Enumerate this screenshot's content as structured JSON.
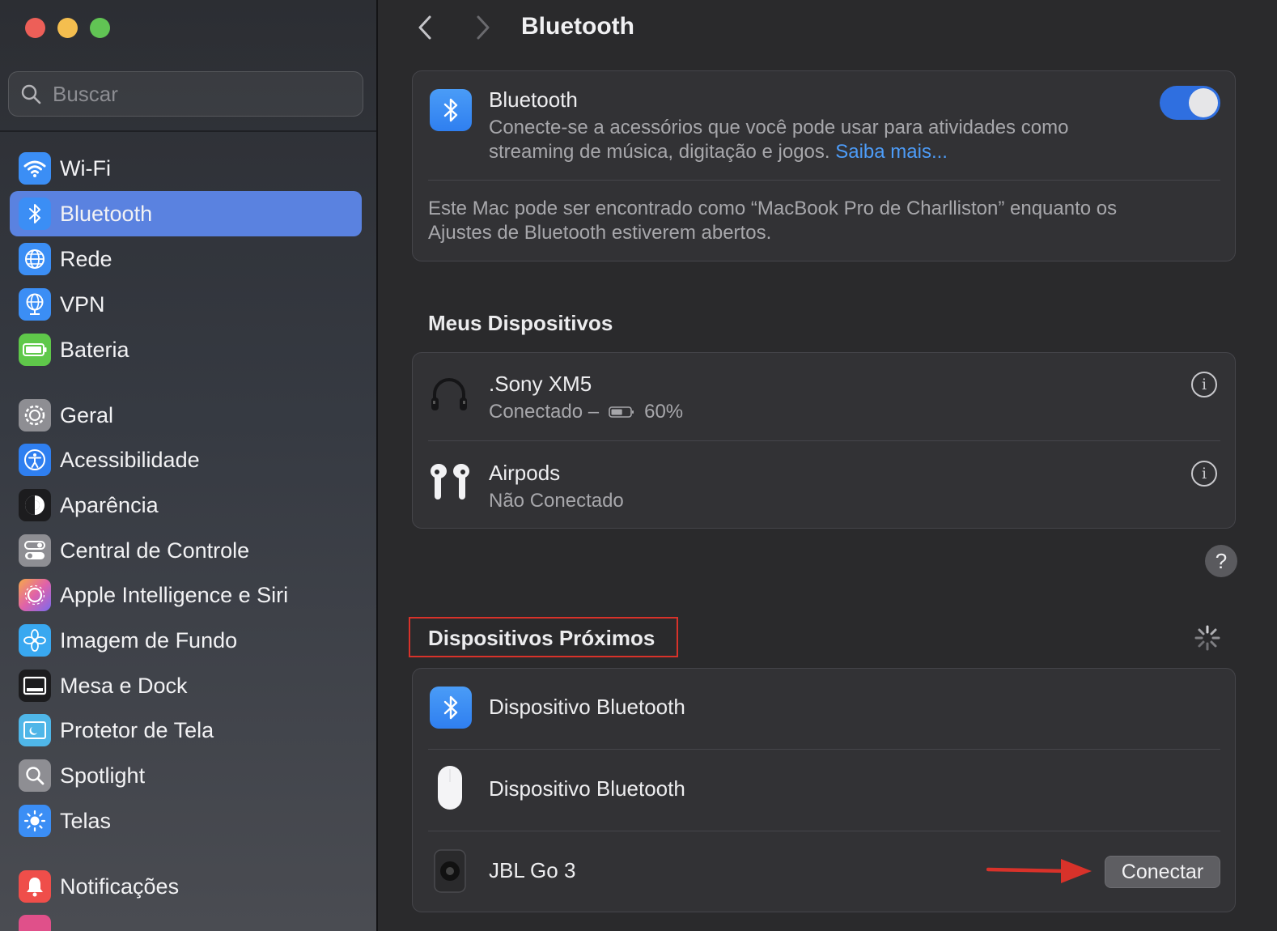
{
  "window": {
    "title": "Bluetooth"
  },
  "search": {
    "placeholder": "Buscar"
  },
  "sidebar": {
    "items": [
      {
        "label": "Wi-Fi",
        "icon": "wifi-icon",
        "color": "#3b8ef5",
        "active": false
      },
      {
        "label": "Bluetooth",
        "icon": "bluetooth-icon",
        "color": "#3b8ef5",
        "active": true
      },
      {
        "label": "Rede",
        "icon": "globe-icon",
        "color": "#3b8ef5",
        "active": false
      },
      {
        "label": "VPN",
        "icon": "vpn-globe-icon",
        "color": "#3b8ef5",
        "active": false
      },
      {
        "label": "Bateria",
        "icon": "battery-icon",
        "color": "#5fc84a",
        "active": false
      },
      {
        "label": "Geral",
        "icon": "gear-icon",
        "color": "#8e8e93",
        "active": false
      },
      {
        "label": "Acessibilidade",
        "icon": "accessibility-icon",
        "color": "#2f7ff0",
        "active": false
      },
      {
        "label": "Aparência",
        "icon": "appearance-icon",
        "color": "#1c1c1e",
        "active": false
      },
      {
        "label": "Central de Controle",
        "icon": "control-center-icon",
        "color": "#8e8e93",
        "active": false
      },
      {
        "label": "Apple Intelligence e Siri",
        "icon": "siri-icon",
        "color": "#e062a8",
        "active": false
      },
      {
        "label": "Imagem de Fundo",
        "icon": "wallpaper-icon",
        "color": "#39a8f0",
        "active": false
      },
      {
        "label": "Mesa e Dock",
        "icon": "dock-icon",
        "color": "#1c1c1e",
        "active": false
      },
      {
        "label": "Protetor de Tela",
        "icon": "screensaver-icon",
        "color": "#4fb6e8",
        "active": false
      },
      {
        "label": "Spotlight",
        "icon": "spotlight-icon",
        "color": "#8e8e93",
        "active": false
      },
      {
        "label": "Telas",
        "icon": "displays-icon",
        "color": "#3b8ef5",
        "active": false
      },
      {
        "label": "Notificações",
        "icon": "notifications-icon",
        "color": "#ef4e4a",
        "active": false
      }
    ]
  },
  "bluetooth_card": {
    "title": "Bluetooth",
    "description": "Conecte-se a acessórios que você pode usar para atividades como",
    "description2": "streaming de música, digitação e jogos.",
    "link": "Saiba mais...",
    "toggle_on": true,
    "discoverable_line1": "Este Mac pode ser encontrado como “MacBook Pro de Charlliston” enquanto os",
    "discoverable_line2": "Ajustes de Bluetooth estiverem abertos."
  },
  "my_devices": {
    "title": "Meus Dispositivos",
    "items": [
      {
        "name": ".Sony XM5",
        "status": "Conectado –",
        "battery": "60%",
        "battery_level": 0.6,
        "icon": "headphones-icon"
      },
      {
        "name": "Airpods",
        "status": "Não Conectado",
        "icon": "airpods-icon"
      }
    ]
  },
  "help": {
    "label": "?"
  },
  "nearby_devices": {
    "title": "Dispositivos Próximos",
    "items": [
      {
        "name": "Dispositivo Bluetooth",
        "icon": "bluetooth-icon"
      },
      {
        "name": "Dispositivo Bluetooth",
        "icon": "magic-mouse-icon"
      },
      {
        "name": "JBL Go 3",
        "icon": "speaker-icon",
        "action": "Conectar"
      }
    ]
  },
  "colors": {
    "accent": "#2f6fe0",
    "sidebar_selected": "#5a82e0",
    "link": "#4d9cf8",
    "highlight": "#d8322a"
  }
}
